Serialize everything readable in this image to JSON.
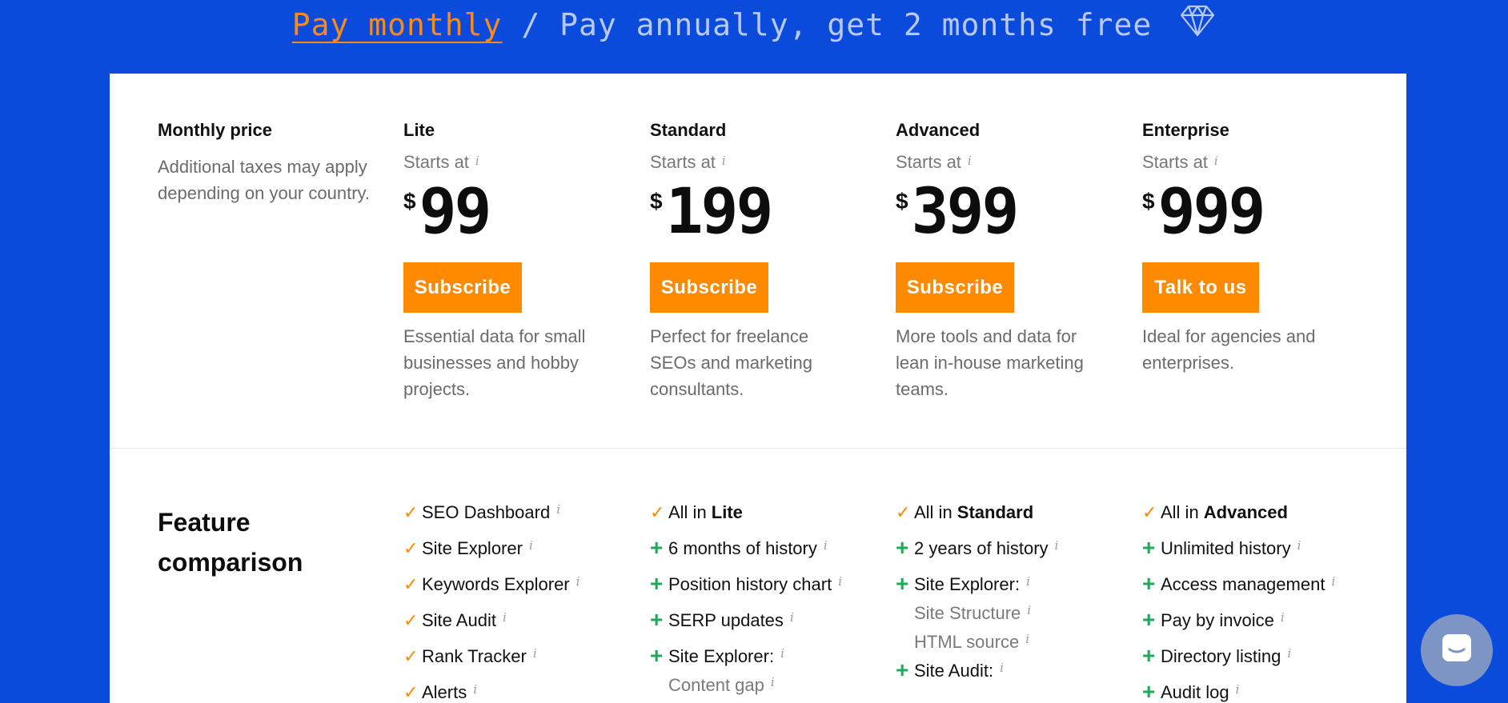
{
  "billing": {
    "monthly_label": "Pay monthly",
    "separator": " / ",
    "annual_label": "Pay annually, get 2 months free"
  },
  "label_column": {
    "title": "Monthly price",
    "description": "Additional taxes may apply depending on your country."
  },
  "plans": [
    {
      "name": "Lite",
      "starts": "Starts at",
      "currency": "$",
      "price": "99",
      "button": "Subscribe",
      "description": "Essential data for small businesses and hobby projects."
    },
    {
      "name": "Standard",
      "starts": "Starts at",
      "currency": "$",
      "price": "199",
      "button": "Subscribe",
      "description": "Perfect for freelance SEOs and marketing consultants."
    },
    {
      "name": "Advanced",
      "starts": "Starts at",
      "currency": "$",
      "price": "399",
      "button": "Subscribe",
      "description": "More tools and data for lean in-house marketing teams."
    },
    {
      "name": "Enterprise",
      "starts": "Starts at",
      "currency": "$",
      "price": "999",
      "button": "Talk to us",
      "description": "Ideal for agencies and enterprises."
    }
  ],
  "info_glyph": "i",
  "feature_section": {
    "title": "Feature comparison",
    "lite": [
      {
        "text": "SEO Dashboard"
      },
      {
        "text": "Site Explorer"
      },
      {
        "text": "Keywords Explorer"
      },
      {
        "text": "Site Audit"
      },
      {
        "text": "Rank Tracker"
      },
      {
        "text": "Alerts"
      }
    ],
    "standard": {
      "all_in_prefix": "All in ",
      "all_in_plan": "Lite",
      "items": [
        "6 months of history",
        "Position history chart",
        "SERP updates",
        "Site Explorer:"
      ],
      "sub_items": [
        "Content gap"
      ]
    },
    "advanced": {
      "all_in_prefix": "All in ",
      "all_in_plan": "Standard",
      "items": [
        "2 years of history",
        "Site Explorer:"
      ],
      "site_explorer_subs": [
        "Site Structure",
        "HTML source"
      ],
      "site_audit": "Site Audit:"
    },
    "enterprise": {
      "all_in_prefix": "All in ",
      "all_in_plan": "Advanced",
      "items": [
        "Unlimited history",
        "Access management",
        "Pay by invoice",
        "Directory listing",
        "Audit log"
      ]
    }
  },
  "colors": {
    "background": "#0b4bdb",
    "accent": "#ff8a00",
    "plus": "#22a85a",
    "chat_bubble": "#7d95c4"
  }
}
